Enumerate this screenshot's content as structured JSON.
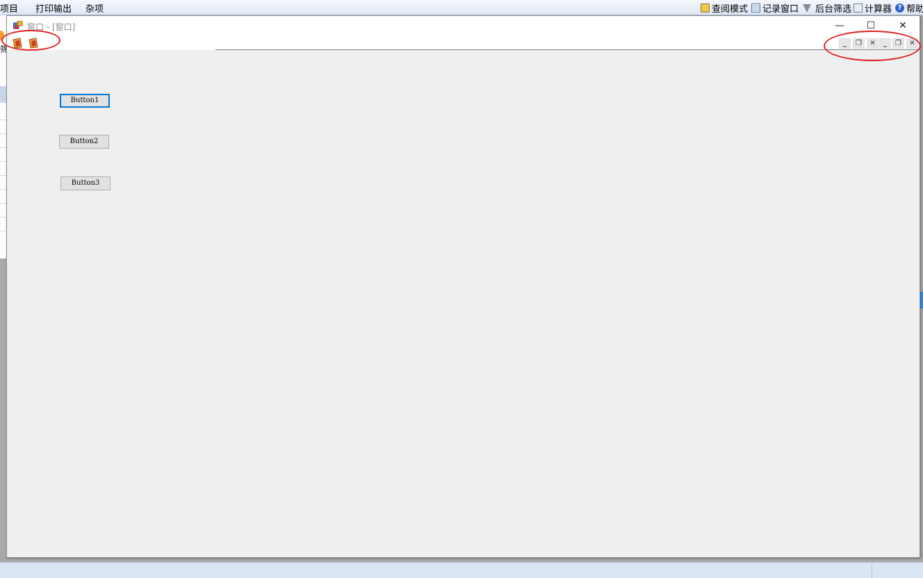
{
  "host": {
    "menu": {
      "item_partial": "项目",
      "print_output": "打印输出",
      "misc": "杂项"
    },
    "toolbar": {
      "readonly_mode": "查阅模式",
      "record_window": "记录窗口",
      "backend_filter": "后台筛选",
      "calculator": "计算器",
      "help_partial": "帮助"
    },
    "left_fragment": "筛"
  },
  "window": {
    "title": "窗口 - [窗口]",
    "controls": {
      "minimize": "—",
      "maximize": "☐",
      "close": "✕"
    },
    "mdi_controls": {
      "child1": {
        "minimize": "_",
        "restore": "❐",
        "close": "✕"
      },
      "child2": {
        "minimize": "_",
        "restore": "❐",
        "close": "✕"
      }
    }
  },
  "buttons": {
    "button1": "Button1",
    "button2": "Button2",
    "button3": "Button3"
  },
  "colors": {
    "highlight": "#e02020",
    "focus": "#0078d7",
    "client_background": "#efefef"
  },
  "icons": {
    "title": "app-window-icon",
    "strip": [
      "mdi-child-icon",
      "mdi-child-icon"
    ]
  }
}
